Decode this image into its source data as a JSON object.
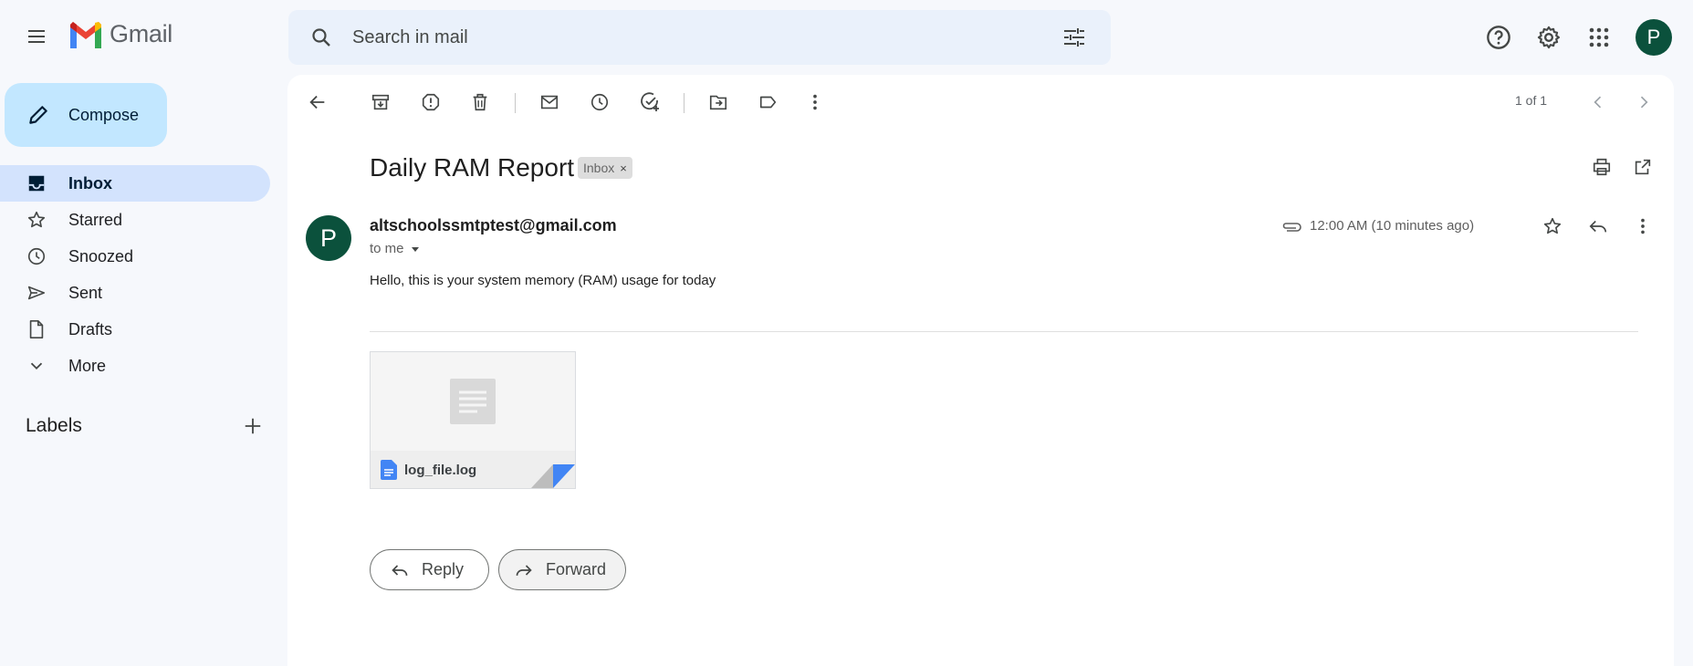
{
  "app": {
    "name": "Gmail"
  },
  "search": {
    "placeholder": "Search in mail"
  },
  "account": {
    "avatar_letter": "P"
  },
  "compose": {
    "label": "Compose"
  },
  "sidebar": {
    "items": [
      {
        "label": "Inbox",
        "icon": "inbox-icon",
        "active": true
      },
      {
        "label": "Starred",
        "icon": "star-icon"
      },
      {
        "label": "Snoozed",
        "icon": "clock-icon"
      },
      {
        "label": "Sent",
        "icon": "send-icon"
      },
      {
        "label": "Drafts",
        "icon": "draft-icon"
      },
      {
        "label": "More",
        "icon": "chevron-down-icon"
      }
    ],
    "labels_title": "Labels"
  },
  "toolbar": {
    "pager": "1 of 1"
  },
  "message": {
    "subject": "Daily RAM Report",
    "badge": "Inbox",
    "badge_close": "×",
    "sender_initial": "P",
    "sender": "altschoolssmtptest@gmail.com",
    "to": "to me",
    "time": "12:00 AM (10 minutes ago)",
    "body": "Hello, this is your system memory (RAM) usage for today",
    "attachment": {
      "name": "log_file.log"
    }
  },
  "actions": {
    "reply": "Reply",
    "forward": "Forward"
  },
  "colors": {
    "accent": "#0b57d0",
    "avatar": "#0b513c",
    "compose": "#c2e7ff",
    "active_nav": "#d3e3fd"
  }
}
